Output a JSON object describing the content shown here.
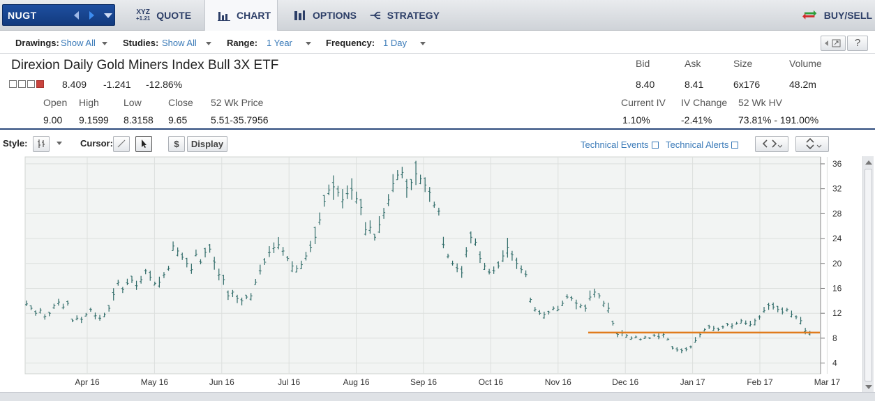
{
  "nav": {
    "symbol": "NUGT",
    "tabs": [
      {
        "label": "QUOTE",
        "icon": "xyz-quote-icon",
        "icon_text": "XYZ",
        "icon_sub": "+1.21"
      },
      {
        "label": "CHART",
        "icon": "bar-chart-icon"
      },
      {
        "label": "OPTIONS",
        "icon": "options-icon"
      },
      {
        "label": "STRATEGY",
        "icon": "strategy-icon"
      }
    ],
    "buy_sell": "BUY/SELL",
    "active_tab": "CHART"
  },
  "toolbar": {
    "drawings_label": "Drawings:",
    "drawings_value": "Show All",
    "studies_label": "Studies:",
    "studies_value": "Show All",
    "range_label": "Range:",
    "range_value": "1 Year",
    "frequency_label": "Frequency:",
    "frequency_value": "1 Day",
    "help": "?"
  },
  "quote": {
    "name": "Direxion Daily Gold Miners Index Bull 3X ETF",
    "last": "8.409",
    "change": "-1.241",
    "change_pct": "-12.86%",
    "open_label": "Open",
    "open": "9.00",
    "high_label": "High",
    "high": "9.1599",
    "low_label": "Low",
    "low": "8.3158",
    "close_label": "Close",
    "close": "9.65",
    "wk52_label": "52 Wk Price",
    "wk52": "5.51-35.7956",
    "bid_label": "Bid",
    "bid": "8.40",
    "ask_label": "Ask",
    "ask": "8.41",
    "size_label": "Size",
    "size": "6x176",
    "volume_label": "Volume",
    "volume": "48.2m",
    "iv_label": "Current IV",
    "iv": "1.10%",
    "ivchg_label": "IV Change",
    "ivchg": "-2.41%",
    "hv_label": "52 Wk HV",
    "hv": "73.81% - 191.00%"
  },
  "chart_controls": {
    "style_label": "Style:",
    "cursor_label": "Cursor:",
    "dollar": "$",
    "display": "Display",
    "tech_events": "Technical Events",
    "tech_alerts": "Technical Alerts"
  },
  "colors": {
    "accent_blue": "#3a7ab8",
    "bar_color": "#2f6b68",
    "trendline": "#e07b1c",
    "chart_bg": "#f2f4f3"
  },
  "chart_data": {
    "type": "line",
    "style": "ohlc-bars",
    "xlabel": "",
    "ylabel": "",
    "ylim": [
      2.5,
      37
    ],
    "yticks": [
      4,
      8,
      12,
      16,
      20,
      24,
      28,
      32,
      36
    ],
    "grid": true,
    "month_labels": [
      "Apr 16",
      "May 16",
      "Jun 16",
      "Jul 16",
      "Aug 16",
      "Sep 16",
      "Oct 16",
      "Nov 16",
      "Dec 16",
      "Jan 17",
      "Feb 17",
      "Mar 17"
    ],
    "series": [
      {
        "values": [
          [
            0,
            13.5
          ],
          [
            3,
            12.8
          ],
          [
            6,
            12.0
          ],
          [
            9,
            12.5
          ],
          [
            12,
            11.5
          ],
          [
            15,
            12.0
          ],
          [
            18,
            13.2
          ],
          [
            21,
            13.8
          ],
          [
            24,
            13.0
          ],
          [
            27,
            13.6
          ],
          [
            30,
            10.8
          ],
          [
            33,
            11.2
          ],
          [
            36,
            11.0
          ],
          [
            39,
            11.8
          ],
          [
            42,
            12.6
          ],
          [
            45,
            11.6
          ],
          [
            48,
            11.2
          ],
          [
            51,
            11.8
          ],
          [
            54,
            12.8
          ],
          [
            57,
            15.0
          ],
          [
            60,
            17.0
          ],
          [
            63,
            15.8
          ],
          [
            66,
            16.8
          ],
          [
            69,
            17.3
          ],
          [
            72,
            16.4
          ],
          [
            75,
            17.4
          ],
          [
            78,
            18.8
          ],
          [
            81,
            17.8
          ],
          [
            84,
            16.8
          ],
          [
            87,
            17.0
          ],
          [
            90,
            18.2
          ],
          [
            93,
            19.2
          ],
          [
            96,
            22.8
          ],
          [
            99,
            22.0
          ],
          [
            102,
            21.0
          ],
          [
            105,
            20.0
          ],
          [
            108,
            19.0
          ],
          [
            111,
            21.5
          ],
          [
            114,
            20.2
          ],
          [
            117,
            21.8
          ],
          [
            120,
            22.3
          ],
          [
            123,
            20.2
          ],
          [
            126,
            18.2
          ],
          [
            129,
            17.4
          ],
          [
            132,
            14.8
          ],
          [
            135,
            15.4
          ],
          [
            138,
            14.4
          ],
          [
            141,
            14.0
          ],
          [
            144,
            14.6
          ],
          [
            147,
            14.8
          ],
          [
            150,
            17.0
          ],
          [
            153,
            18.8
          ],
          [
            156,
            20.2
          ],
          [
            159,
            21.8
          ],
          [
            162,
            22.6
          ],
          [
            165,
            23.0
          ],
          [
            168,
            22.0
          ],
          [
            171,
            20.8
          ],
          [
            174,
            19.6
          ],
          [
            177,
            19.2
          ],
          [
            180,
            19.8
          ],
          [
            183,
            21.2
          ],
          [
            186,
            22.6
          ],
          [
            189,
            24.2
          ],
          [
            192,
            27.0
          ],
          [
            195,
            30.0
          ],
          [
            198,
            31.8
          ],
          [
            201,
            32.3
          ],
          [
            204,
            31.4
          ],
          [
            207,
            30.2
          ],
          [
            210,
            31.2
          ],
          [
            213,
            31.8
          ],
          [
            216,
            30.4
          ],
          [
            219,
            29.0
          ],
          [
            222,
            25.4
          ],
          [
            225,
            25.8
          ],
          [
            228,
            24.2
          ],
          [
            231,
            26.2
          ],
          [
            234,
            28.2
          ],
          [
            237,
            30.2
          ],
          [
            240,
            32.8
          ],
          [
            243,
            34.2
          ],
          [
            246,
            34.6
          ],
          [
            249,
            32.2
          ],
          [
            252,
            33.0
          ],
          [
            255,
            34.4
          ],
          [
            258,
            33.6
          ],
          [
            261,
            32.6
          ],
          [
            264,
            31.4
          ],
          [
            267,
            29.4
          ],
          [
            270,
            28.4
          ],
          [
            273,
            23.0
          ],
          [
            276,
            21.2
          ],
          [
            279,
            20.0
          ],
          [
            282,
            19.2
          ],
          [
            285,
            18.5
          ],
          [
            288,
            22.0
          ],
          [
            291,
            24.2
          ],
          [
            294,
            23.4
          ],
          [
            297,
            20.8
          ],
          [
            300,
            19.6
          ],
          [
            303,
            18.6
          ],
          [
            306,
            18.8
          ],
          [
            309,
            19.6
          ],
          [
            312,
            21.2
          ],
          [
            315,
            22.6
          ],
          [
            318,
            21.4
          ],
          [
            321,
            20.0
          ],
          [
            324,
            19.0
          ],
          [
            327,
            18.2
          ],
          [
            330,
            14.2
          ],
          [
            333,
            12.6
          ],
          [
            336,
            12.0
          ],
          [
            339,
            11.8
          ],
          [
            342,
            12.2
          ],
          [
            345,
            12.8
          ],
          [
            348,
            12.6
          ],
          [
            351,
            13.6
          ],
          [
            354,
            14.6
          ],
          [
            357,
            14.4
          ],
          [
            360,
            13.6
          ],
          [
            363,
            13.2
          ],
          [
            366,
            12.8
          ],
          [
            369,
            14.6
          ],
          [
            372,
            15.4
          ],
          [
            375,
            14.8
          ],
          [
            378,
            13.6
          ],
          [
            381,
            12.8
          ],
          [
            384,
            10.4
          ],
          [
            387,
            8.6
          ],
          [
            390,
            8.8
          ],
          [
            393,
            8.4
          ],
          [
            396,
            8.0
          ],
          [
            399,
            8.2
          ],
          [
            402,
            7.8
          ],
          [
            405,
            8.2
          ],
          [
            408,
            8.0
          ],
          [
            411,
            8.4
          ],
          [
            414,
            8.2
          ],
          [
            417,
            8.6
          ],
          [
            420,
            7.8
          ],
          [
            423,
            6.4
          ],
          [
            426,
            6.1
          ],
          [
            429,
            6.0
          ],
          [
            432,
            6.2
          ],
          [
            435,
            6.6
          ],
          [
            438,
            7.6
          ],
          [
            441,
            8.6
          ],
          [
            444,
            9.4
          ],
          [
            447,
            9.8
          ],
          [
            450,
            9.6
          ],
          [
            453,
            9.4
          ],
          [
            456,
            9.8
          ],
          [
            459,
            10.2
          ],
          [
            462,
            10.0
          ],
          [
            465,
            10.4
          ],
          [
            468,
            10.8
          ],
          [
            471,
            10.4
          ],
          [
            474,
            10.2
          ],
          [
            477,
            10.8
          ],
          [
            480,
            11.4
          ],
          [
            483,
            12.4
          ],
          [
            486,
            13.2
          ],
          [
            489,
            13.0
          ],
          [
            492,
            12.6
          ],
          [
            495,
            12.2
          ],
          [
            498,
            12.6
          ],
          [
            501,
            11.8
          ],
          [
            504,
            11.4
          ],
          [
            507,
            10.8
          ],
          [
            510,
            9.2
          ],
          [
            513,
            8.9
          ]
        ]
      },
      {
        "name": "",
        "values": [
          [
            450,
            8.9
          ],
          [
            830,
            8.9
          ]
        ]
      }
    ]
  }
}
